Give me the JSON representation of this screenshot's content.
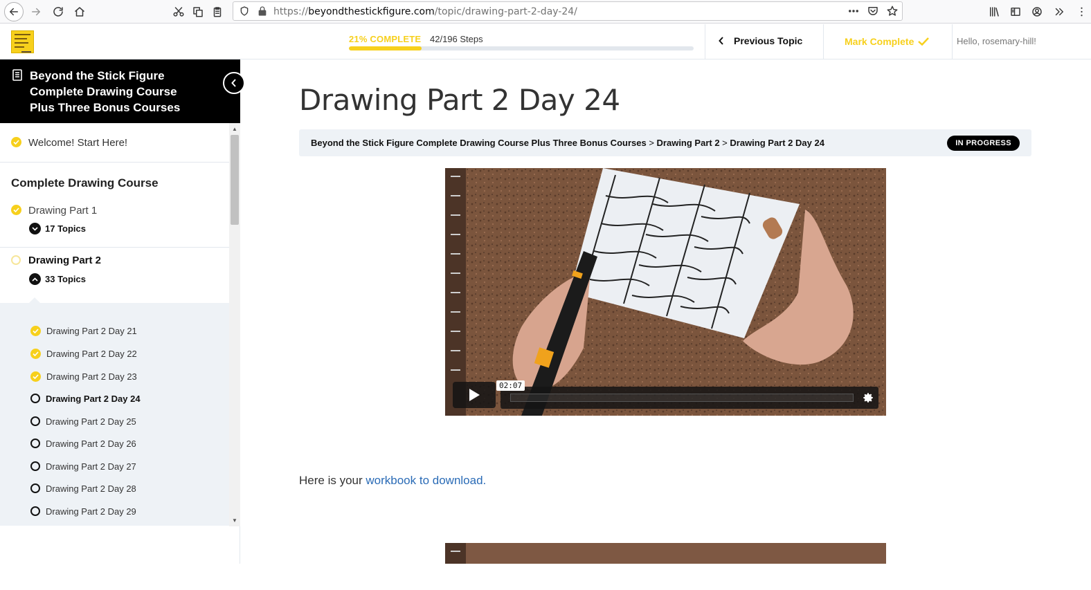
{
  "browser": {
    "url_prefix": "https://",
    "url_domain": "beyondthestickfigure.com",
    "url_path": "/topic/drawing-part-2-day-24/",
    "icons": [
      "back-icon",
      "forward-icon",
      "reload-icon",
      "home-icon",
      "cut-icon",
      "copy-icon",
      "paste-icon",
      "shield-icon",
      "lock-icon",
      "more-icon",
      "pocket-icon",
      "star-icon",
      "library-icon",
      "sidebar-icon",
      "account-icon",
      "overflow-icon"
    ]
  },
  "header": {
    "progress_label": "21% COMPLETE",
    "progress_fraction": 0.21,
    "steps_label": "42/196 Steps",
    "previous_topic": "Previous Topic",
    "mark_complete": "Mark Complete",
    "greeting": "Hello, rosemary-hill!"
  },
  "sidebar": {
    "course_title": "Beyond the Stick Figure Complete Drawing Course Plus Three Bonus Courses",
    "welcome": "Welcome! Start Here!",
    "section_title": "Complete Drawing Course",
    "lessons": [
      {
        "title": "Drawing Part 1",
        "topics": "17 Topics",
        "status": "complete"
      },
      {
        "title": "Drawing Part 2",
        "topics": "33 Topics",
        "status": "in-progress"
      }
    ],
    "topics": [
      {
        "label": "Drawing Part 2 Day 21",
        "status": "complete"
      },
      {
        "label": "Drawing Part 2 Day 22",
        "status": "complete"
      },
      {
        "label": "Drawing Part 2 Day 23",
        "status": "complete"
      },
      {
        "label": "Drawing Part 2 Day 24",
        "status": "current"
      },
      {
        "label": "Drawing Part 2 Day 25",
        "status": "incomplete"
      },
      {
        "label": "Drawing Part 2 Day 26",
        "status": "incomplete"
      },
      {
        "label": "Drawing Part 2 Day 27",
        "status": "incomplete"
      },
      {
        "label": "Drawing Part 2 Day 28",
        "status": "incomplete"
      },
      {
        "label": "Drawing Part 2 Day 29",
        "status": "incomplete"
      }
    ]
  },
  "main": {
    "title": "Drawing Part 2 Day 24",
    "breadcrumb": {
      "course": "Beyond the Stick Figure Complete Drawing Course Plus Three Bonus Courses",
      "sep": " > ",
      "lesson": "Drawing Part 2",
      "topic": "Drawing Part 2 Day 24"
    },
    "status_badge": "IN PROGRESS",
    "video": {
      "time": "02:07"
    },
    "workbook_prefix": "Here is your ",
    "workbook_link": "workbook to download."
  },
  "colors": {
    "accent": "#f7d01c",
    "link": "#2a6bb6",
    "panel": "#eef2f6"
  }
}
